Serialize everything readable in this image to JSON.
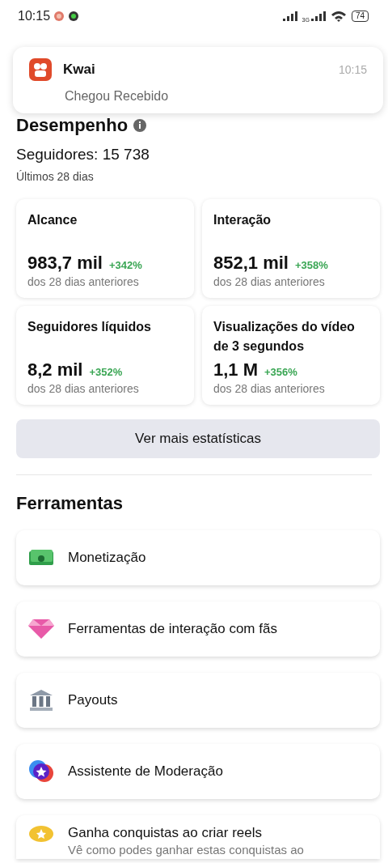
{
  "status_bar": {
    "time": "10:15",
    "network": "3G",
    "battery": "74"
  },
  "notification": {
    "app": "Kwai",
    "time": "10:15",
    "message": "Chegou Recebido"
  },
  "performance": {
    "title": "Desempenho",
    "followers": "Seguidores: 15 738",
    "period": "Últimos 28 dias",
    "cards": [
      {
        "title": "Alcance",
        "value": "983,7 mil",
        "change": "+342%",
        "note": "dos 28 dias anteriores"
      },
      {
        "title": "Interação",
        "value": "852,1 mil",
        "change": "+358%",
        "note": "dos 28 dias anteriores"
      },
      {
        "title": "Seguidores líquidos",
        "value": "8,2 mil",
        "change": "+352%",
        "note": "dos 28 dias anteriores"
      },
      {
        "title": "Visualizações do vídeo de 3 segundos",
        "value": "1,1 M",
        "change": "+356%",
        "note": "dos 28 dias anteriores"
      }
    ],
    "more_button": "Ver mais estatísticas"
  },
  "tools": {
    "title": "Ferramentas",
    "items": [
      {
        "kind": "money",
        "label": "Monetização"
      },
      {
        "kind": "gem",
        "label": "Ferramentas de interação com fãs"
      },
      {
        "kind": "bank",
        "label": "Payouts"
      },
      {
        "kind": "moderation",
        "label": "Assistente de Moderação"
      },
      {
        "kind": "badge",
        "label": "Ganha conquistas ao criar reels",
        "subtitle": "Vê como podes ganhar estas conquistas ao"
      }
    ]
  }
}
